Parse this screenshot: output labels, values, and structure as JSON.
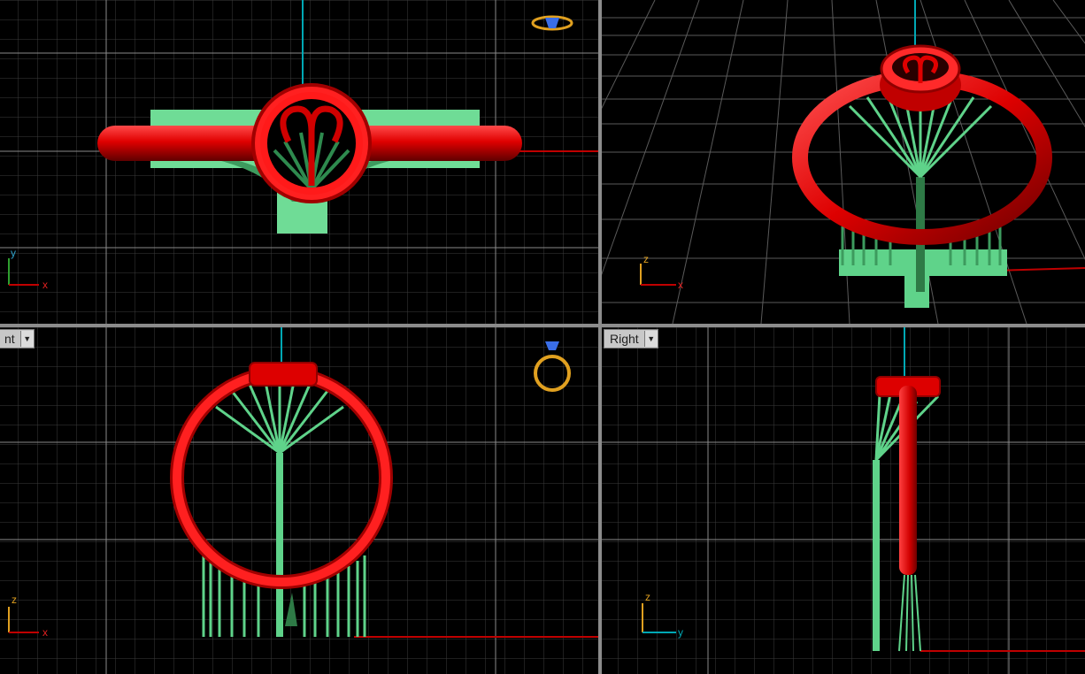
{
  "viewports": {
    "top": {
      "axis_x": "x",
      "axis_y": "y"
    },
    "perspective": {
      "axis_x": "x",
      "axis_y": "z"
    },
    "front": {
      "tab_label": "nt",
      "axis_x": "x",
      "axis_y": "z"
    },
    "right": {
      "tab_label": "Right",
      "axis_x": "y",
      "axis_y": "z"
    }
  },
  "icons": {
    "tab_dropdown": "chevron-down-icon",
    "ring_preview": "ring-preview-icon"
  },
  "colors": {
    "background": "#000000",
    "grid_major": "#8a8a8a",
    "grid_minor": "#3c3c3c",
    "ring": "#e00000",
    "supports": "#5fd38a",
    "axis_x": "#c00000",
    "axis_cyan": "#00a8b4",
    "axis_y": "#2f9f2f",
    "preview_gold": "#e0a020",
    "preview_blue": "#3a6ee8"
  }
}
